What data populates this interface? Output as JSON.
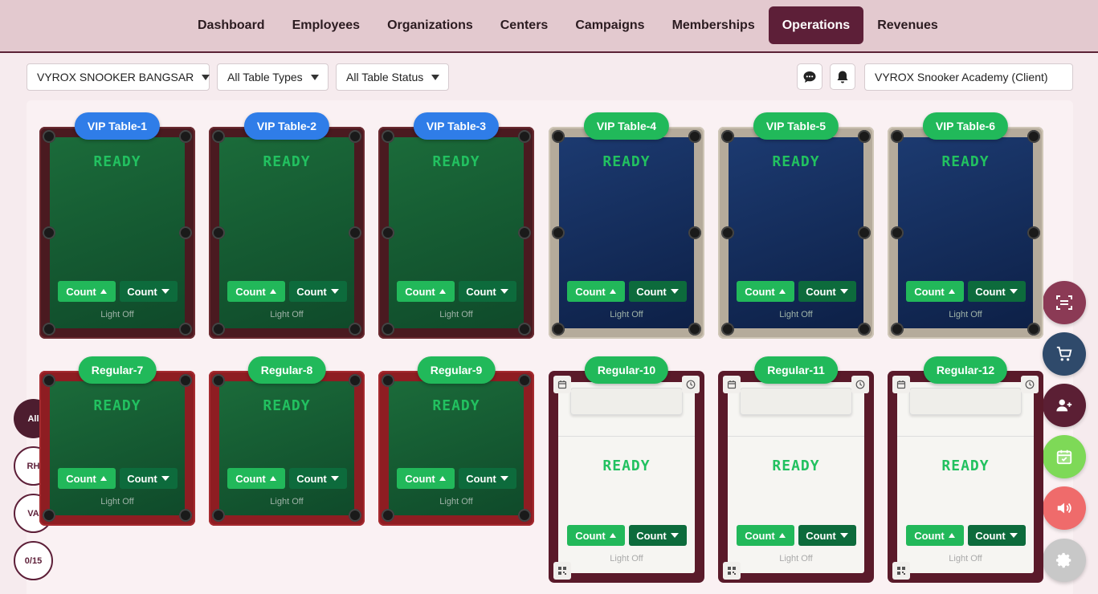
{
  "nav": {
    "links": [
      "Dashboard",
      "Employees",
      "Organizations",
      "Centers",
      "Campaigns",
      "Memberships",
      "Operations",
      "Revenues"
    ],
    "active": "Operations"
  },
  "filters": {
    "center": "VYROX SNOOKER BANGSAR",
    "table_types": "All Table Types",
    "table_status": "All Table Status",
    "client": "VYROX Snooker Academy (Client)"
  },
  "tables": [
    {
      "name": "VIP Table-1",
      "status": "READY",
      "count_up": "Count",
      "count_down": "Count",
      "light": "Light Off"
    },
    {
      "name": "VIP Table-2",
      "status": "READY",
      "count_up": "Count",
      "count_down": "Count",
      "light": "Light Off"
    },
    {
      "name": "VIP Table-3",
      "status": "READY",
      "count_up": "Count",
      "count_down": "Count",
      "light": "Light Off"
    },
    {
      "name": "VIP Table-4",
      "status": "READY",
      "count_up": "Count",
      "count_down": "Count",
      "light": "Light Off"
    },
    {
      "name": "VIP Table-5",
      "status": "READY",
      "count_up": "Count",
      "count_down": "Count",
      "light": "Light Off"
    },
    {
      "name": "VIP Table-6",
      "status": "READY",
      "count_up": "Count",
      "count_down": "Count",
      "light": "Light Off"
    },
    {
      "name": "Regular-7",
      "status": "READY",
      "count_up": "Count",
      "count_down": "Count",
      "light": "Light Off"
    },
    {
      "name": "Regular-8",
      "status": "READY",
      "count_up": "Count",
      "count_down": "Count",
      "light": "Light Off"
    },
    {
      "name": "Regular-9",
      "status": "READY",
      "count_up": "Count",
      "count_down": "Count",
      "light": "Light Off"
    },
    {
      "name": "Regular-10",
      "status": "READY",
      "count_up": "Count",
      "count_down": "Count",
      "light": "Light Off"
    },
    {
      "name": "Regular-11",
      "status": "READY",
      "count_up": "Count",
      "count_down": "Count",
      "light": "Light Off"
    },
    {
      "name": "Regular-12",
      "status": "READY",
      "count_up": "Count",
      "count_down": "Count",
      "light": "Light Off"
    }
  ],
  "side_filters": [
    "All",
    "RH",
    "VA",
    "0/15"
  ],
  "fabs": [
    {
      "icon": "scan-icon",
      "color": "#8b3a55"
    },
    {
      "icon": "cart-icon",
      "color": "#2f4a6b"
    },
    {
      "icon": "add-user-icon",
      "color": "#5b1f34"
    },
    {
      "icon": "calendar-check-icon",
      "color": "#7ed957"
    },
    {
      "icon": "speaker-icon",
      "color": "#ef6b6b"
    },
    {
      "icon": "gear-icon",
      "color": "#c8c8c8"
    }
  ]
}
